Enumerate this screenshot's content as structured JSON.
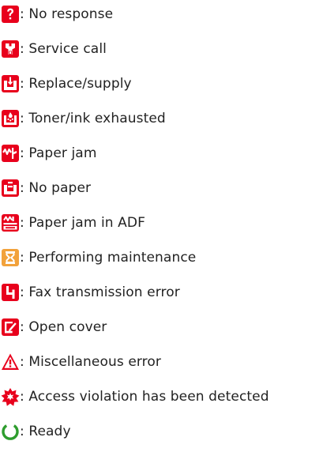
{
  "legend": {
    "items": [
      {
        "icon": "question-mark-icon",
        "label": ": No response"
      },
      {
        "icon": "wrench-icon",
        "label": ": Service call"
      },
      {
        "icon": "replace-supply-icon",
        "label": ": Replace/supply"
      },
      {
        "icon": "toner-exhausted-icon",
        "label": ": Toner/ink exhausted"
      },
      {
        "icon": "paper-jam-icon",
        "label": ": Paper jam"
      },
      {
        "icon": "no-paper-icon",
        "label": ": No paper"
      },
      {
        "icon": "adf-jam-icon",
        "label": ": Paper jam in ADF"
      },
      {
        "icon": "hourglass-icon",
        "label": ": Performing maintenance"
      },
      {
        "icon": "fax-error-icon",
        "label": ": Fax transmission error"
      },
      {
        "icon": "open-cover-icon",
        "label": ": Open cover"
      },
      {
        "icon": "warning-triangle-icon",
        "label": ": Miscellaneous error"
      },
      {
        "icon": "burst-icon",
        "label": ": Access violation has been detected"
      },
      {
        "icon": "power-ready-icon",
        "label": ": Ready"
      }
    ]
  },
  "colors": {
    "error_red": "#e8001c",
    "maintenance_orange": "#f2a23b",
    "ready_green": "#2e9d2e",
    "text": "#222222"
  }
}
